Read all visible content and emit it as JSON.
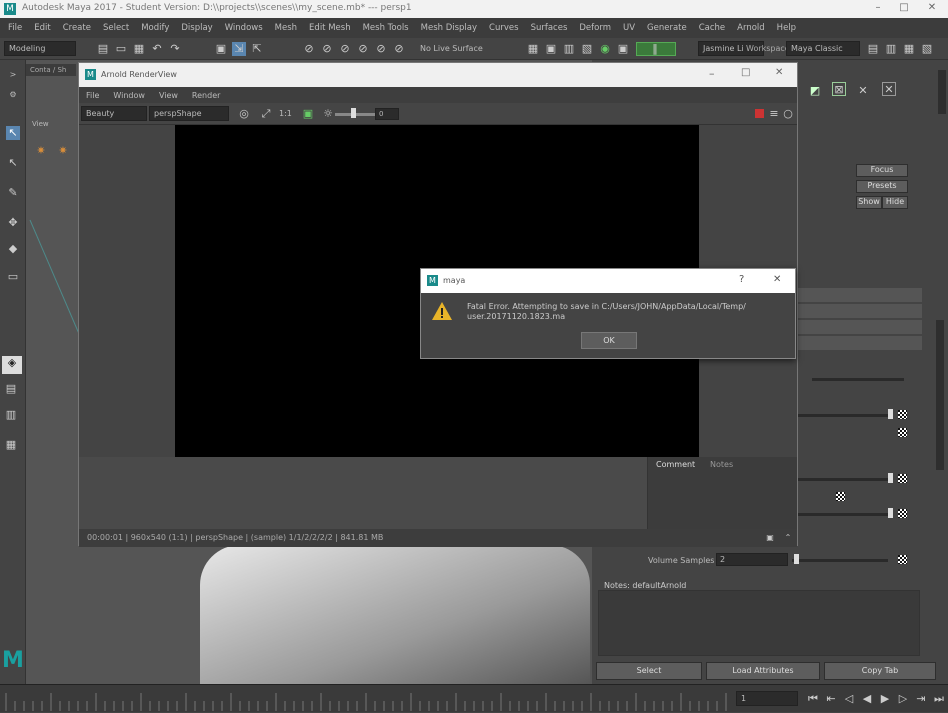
{
  "window": {
    "title": "Autodesk Maya 2017 - Student Version: D:\\\\projects\\\\scenes\\\\my_scene.mb* --- persp1"
  },
  "menubar": [
    "File",
    "Edit",
    "Create",
    "Select",
    "Modify",
    "Display",
    "Windows",
    "Mesh",
    "Edit Mesh",
    "Mesh Tools",
    "Mesh Display",
    "Curves",
    "Surfaces",
    "Deform",
    "UV",
    "Generate",
    "Cache",
    "Arnold",
    "Help"
  ],
  "shelf": {
    "mode": "Modeling",
    "no_live": "No Live Surface",
    "workspace_label": "Workspace:",
    "workspace": "Maya Classic",
    "user": "Jasmine Li"
  },
  "viewport": {
    "menu": [
      "View",
      "Sh"
    ],
    "tab": "Conta / Sh"
  },
  "render_view": {
    "title": "Arnold RenderView",
    "menu": [
      "File",
      "Window",
      "View",
      "Render"
    ],
    "aov": "Beauty",
    "camera": "perspShape",
    "ratio": "1:1",
    "exposure": "0",
    "tabs": [
      "Comment",
      "Notes"
    ],
    "status": "00:00:01 | 960x540 (1:1) | perspShape | (sample) 1/1/2/2/2/2 | 841.81 MB"
  },
  "dialog": {
    "title": "maya",
    "message": "Fatal Error. Attempting to save in C:/Users/JOHN/AppData/Local/Temp/ user.20171120.1823.ma",
    "ok": "OK"
  },
  "attr": {
    "buttons": [
      "Focus",
      "Presets",
      "Show",
      "Hide"
    ],
    "volume_samples_label": "Volume Samples",
    "volume_samples": "2",
    "notes_label": "Notes: defaultArnold",
    "footer": [
      "Select",
      "Load Attributes",
      "Copy Tab"
    ]
  },
  "timeline": {
    "frame": "1"
  }
}
